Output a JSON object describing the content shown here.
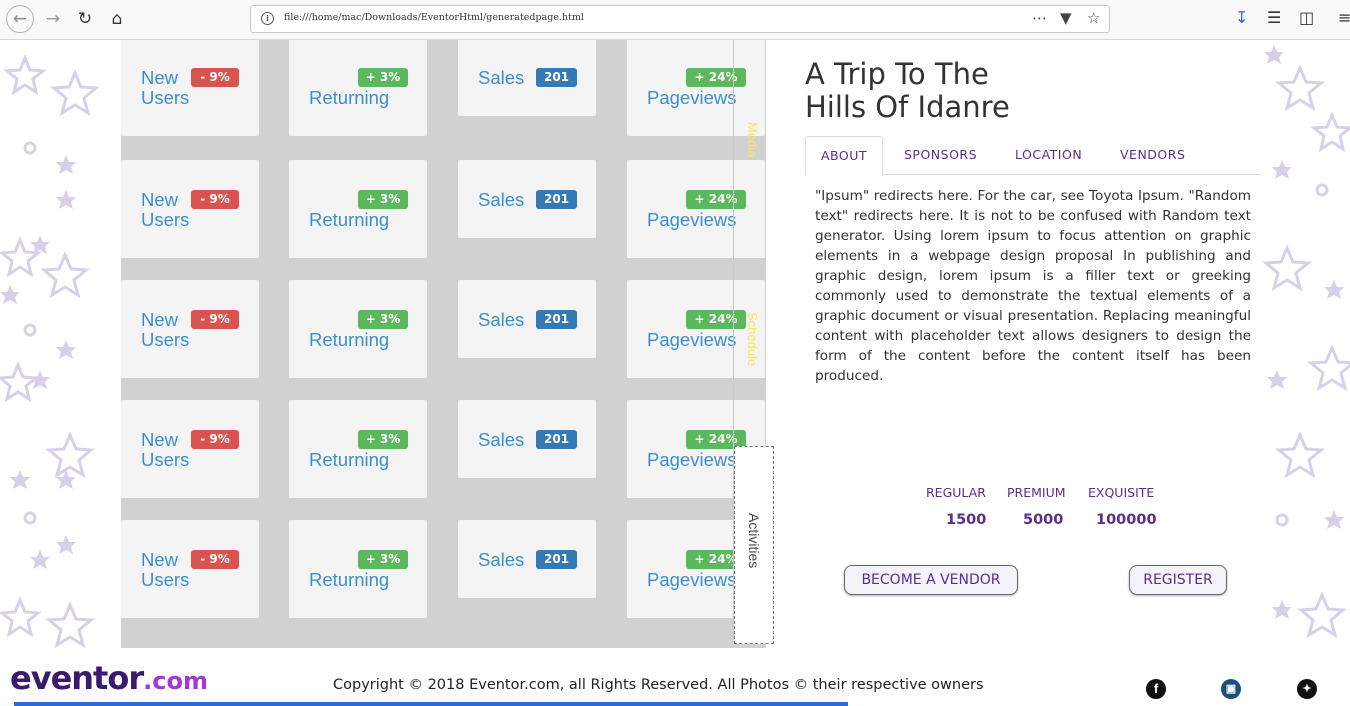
{
  "browser": {
    "url": "file:///home/mac/Downloads/EventorHtml/generatedpage.html"
  },
  "stats_cards": {
    "new_users": {
      "label_line1": "New",
      "label_line2": "Users",
      "badge": "- 9%"
    },
    "returning": {
      "label": "Returning",
      "badge": "+ 3%"
    },
    "sales": {
      "label": "Sales",
      "badge": "201"
    },
    "pageviews": {
      "label": "Pageviews",
      "badge": "+ 24%"
    }
  },
  "side_labels": {
    "media": "Media",
    "schedule": "Schedule",
    "activities": "Activities"
  },
  "event": {
    "title_line1": "A Trip To The",
    "title_line2": "Hills Of Idanre",
    "tabs": [
      "ABOUT",
      "SPONSORS",
      "LOCATION",
      "VENDORS"
    ],
    "about_text": "\"Ipsum\" redirects here. For the car, see Toyota Ipsum. \"Random text\" redirects here. It is not to be confused with Random text generator. Using lorem ipsum to focus attention on graphic elements in a webpage design proposal In publishing and graphic design, lorem ipsum is a filler text or greeking commonly used to demonstrate the textual elements of a graphic document or visual presentation. Replacing meaningful content with placeholder text allows designers to design the form of the content before the content itself has been produced."
  },
  "pricing": [
    {
      "tier": "REGULAR",
      "price": "1500"
    },
    {
      "tier": "PREMIUM",
      "price": "5000"
    },
    {
      "tier": "EXQUISITE",
      "price": "100000"
    }
  ],
  "buttons": {
    "vendor": "BECOME A VENDOR",
    "register": "REGISTER"
  },
  "footer": {
    "logo_main": "eventor",
    "logo_suffix": ".com",
    "copyright": "Copyright © 2018 Eventor.com, all Rights Reserved. All Photos © their respective owners",
    "social": [
      "facebook-icon",
      "instagram-icon",
      "twitter-icon"
    ]
  },
  "colors": {
    "accent_purple": "#5a2e8c",
    "card_label_blue": "#3b8fcf",
    "badge_red": "#d9534f",
    "badge_green": "#5cb85c",
    "badge_blue": "#337ab7"
  }
}
